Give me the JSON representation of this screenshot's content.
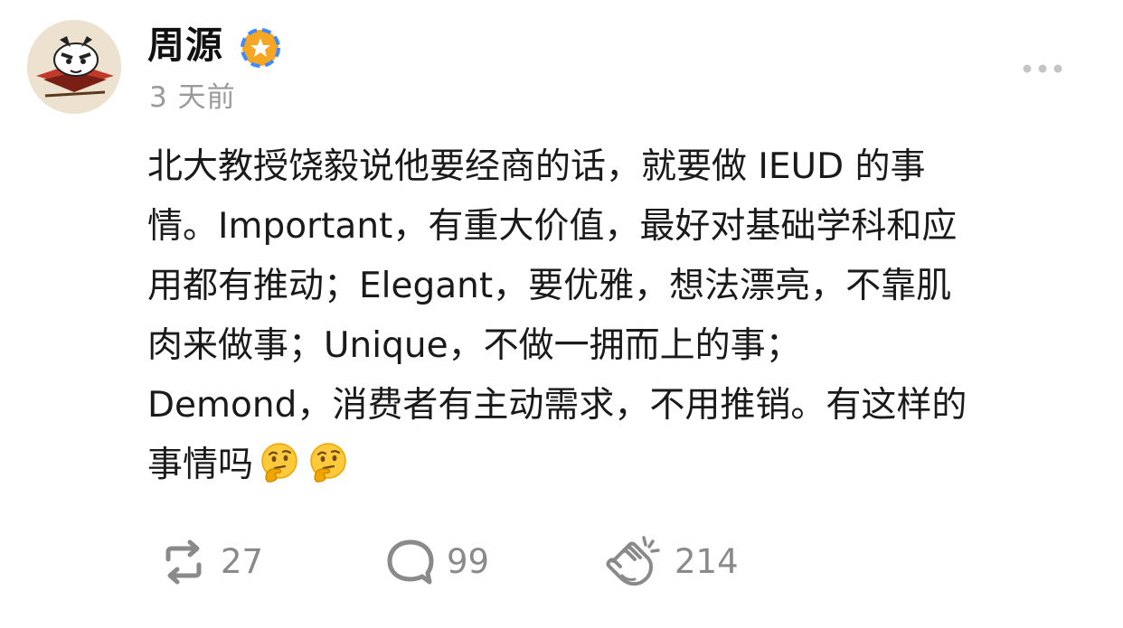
{
  "post": {
    "author": "周源",
    "verified_badge_icon": "verified-badge-icon",
    "timestamp": "3 天前",
    "more_icon": "more-options-icon",
    "text_lines": [
      "北大教授饶毅说他要经商的话，就要做 IEUD 的事",
      "情。Important，有重大价值，最好对基础学科和应",
      "用都有推动；Elegant，要优雅，想法漂亮，不靠肌",
      "肉来做事；Unique，不做一拥而上的事；",
      "Demond，消费者有主动需求，不用推销。有这样的",
      "事情吗"
    ],
    "trailing_emojis": [
      "thinking-face-emoji",
      "thinking-face-emoji"
    ]
  },
  "actions": {
    "repost": {
      "icon": "repost-icon",
      "count": "27"
    },
    "comment": {
      "icon": "comment-icon",
      "count": "99"
    },
    "like": {
      "icon": "clapping-hands-icon",
      "count": "214"
    }
  },
  "colors": {
    "text": "#1a1a1a",
    "secondary_text": "#9a9a9a",
    "action_gray": "#8a8a8a",
    "badge_orange": "#f5a623",
    "badge_blue": "#3d8bff"
  }
}
